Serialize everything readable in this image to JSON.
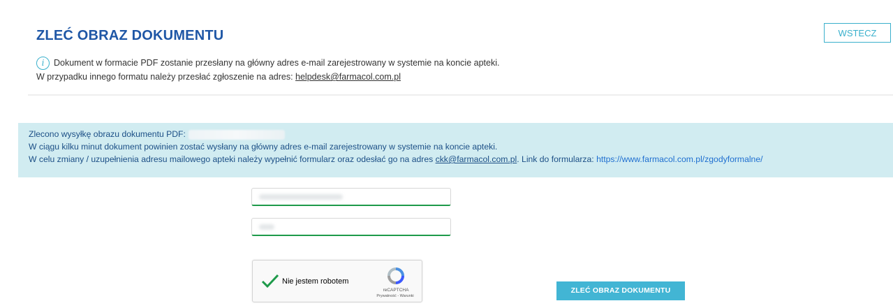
{
  "header": {
    "title": "ZLEĆ OBRAZ DOKUMENTU",
    "back_label": "WSTECZ"
  },
  "info": {
    "line1": "Dokument w formacie PDF zostanie przesłany na główny adres e-mail zarejestrowany w systemie na koncie apteki.",
    "line2_prefix": "W przypadku innego formatu należy przesłać zgłoszenie na adres: ",
    "line2_email": "helpdesk@farmacol.com.pl"
  },
  "alert": {
    "line1_prefix": "Zlecono wysyłkę obrazu dokumentu PDF:",
    "line2": "W ciągu kilku minut dokument powinien zostać wysłany na główny adres e-mail zarejestrowany w systemie na koncie apteki.",
    "line3_prefix": "W celu zmiany / uzupełnienia adresu mailowego apteki należy wypełnić formularz oraz odesłać go na adres ",
    "line3_email": "ckk@farmacol.com.pl",
    "line3_middle": ". Link do formularza: ",
    "line3_link": "https://www.farmacol.com.pl/zgodyformalne/"
  },
  "captcha": {
    "label": "Nie jestem robotem",
    "brand": "reCAPTCHA",
    "terms": "Prywatność - Warunki"
  },
  "submit": {
    "label": "ZLEĆ OBRAZ DOKUMENTU"
  },
  "colors": {
    "title": "#1f57a6",
    "accent": "#3ab0cc",
    "alert_bg": "#d1ecf1",
    "field_ok": "#1e9a4a",
    "submit_bg": "#42b5d4"
  },
  "icons": {
    "info": "info-circle-icon",
    "check": "checkmark-icon",
    "recaptcha": "recaptcha-logo-icon"
  }
}
